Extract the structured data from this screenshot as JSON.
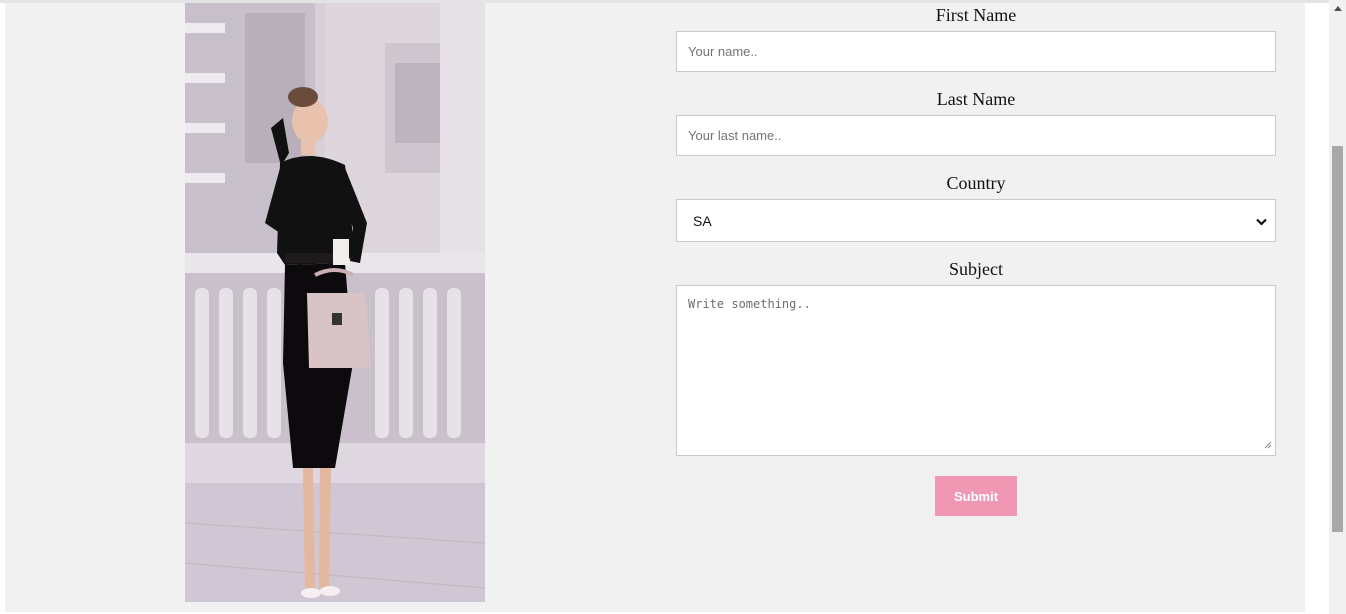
{
  "photo": {
    "alt": "woman in black dress holding a pink handbag"
  },
  "form": {
    "first_name": {
      "label": "First Name",
      "placeholder": "Your name.."
    },
    "last_name": {
      "label": "Last Name",
      "placeholder": "Your last name.."
    },
    "country": {
      "label": "Country",
      "selected": "SA"
    },
    "subject": {
      "label": "Subject",
      "placeholder": "Write something.."
    },
    "submit_label": "Submit"
  },
  "colors": {
    "page_background": "#f1f1f1",
    "submit_button": "#f097b4",
    "scrollbar_thumb": "#a8a8a8"
  },
  "icons": {
    "select_arrow": "chevron-down-icon",
    "scroll_up": "triangle-up-icon",
    "resize": "resize-grip-icon"
  }
}
